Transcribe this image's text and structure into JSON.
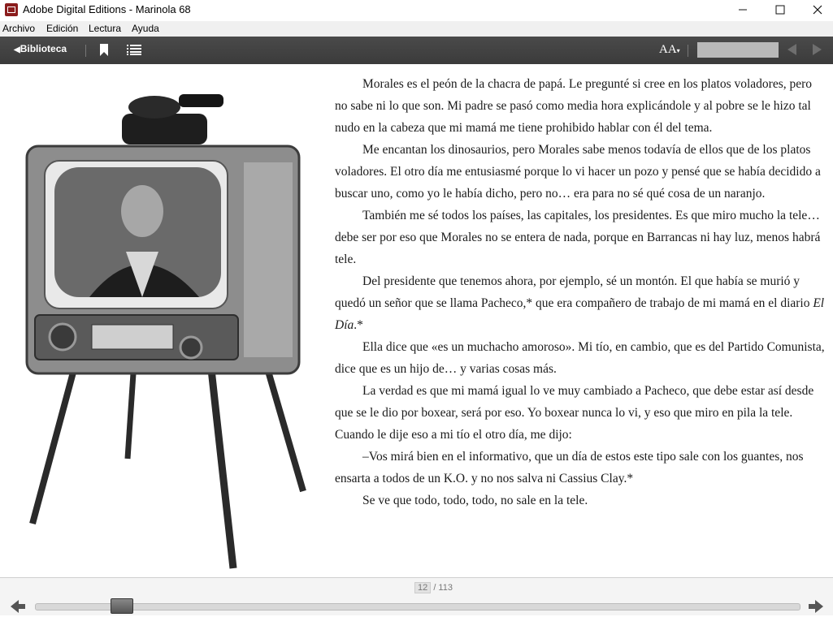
{
  "window": {
    "title": "Adobe Digital Editions - Marinola 68"
  },
  "menu": [
    "Archivo",
    "Edición",
    "Lectura",
    "Ayuda"
  ],
  "toolbar": {
    "library_label": "Biblioteca",
    "font_size_label": "AA",
    "search_value": ""
  },
  "page": {
    "paragraphs": [
      "Morales es el peón de la chacra de papá. Le pregunté si cree en los platos voladores, pero no sabe ni lo que son. Mi padre se pasó como media hora explicándole y al pobre se le hizo tal nudo en la cabeza que mi mamá me tiene prohibido hablar con él del tema.",
      "Me encantan los dinosaurios, pero Morales sabe menos todavía de ellos que de los platos voladores. El otro día me entusiasmé porque lo vi hacer un pozo y pensé que se había decidido a buscar uno, como yo le había dicho, pero no… era para no sé qué cosa de un naranjo.",
      "También me sé todos los países, las capitales, los presidentes. Es que miro mucho la tele… debe ser por eso que Morales no se entera de nada, porque en Barrancas ni hay luz, menos habrá tele.",
      "Del presidente que tenemos ahora, por ejemplo, sé un montón. El que había se murió y quedó un señor que se llama Pacheco,* que era compañero de trabajo de mi mamá en el diario ",
      "Ella dice que «es un muchacho amoroso». Mi tío, en cambio, que es del Partido Comunista, dice que es un hijo de… y varias cosas más.",
      "La verdad es que mi mamá igual lo ve muy cambiado a Pacheco, que debe estar así desde que se le dio por boxear, será por eso. Yo boxear nunca lo vi, y eso que miro en pila la tele. Cuando le dije eso a mi tío el otro día, me dijo:",
      "–Vos mirá bien en el informativo, que un día de estos este tipo sale con los guantes, nos ensarta a todos de un K.O. y no nos salva ni Cassius Clay.*",
      "Se ve que todo, todo, todo, no sale en la tele."
    ],
    "italic_newspaper": "El Día",
    "italic_suffix": ".*"
  },
  "footer": {
    "current_page": "12",
    "total_pages": "/ 113",
    "progress_fraction": 0.113
  },
  "colors": {
    "toolbar_bg": "#3f3f3f",
    "text": "#1a1a1a"
  }
}
